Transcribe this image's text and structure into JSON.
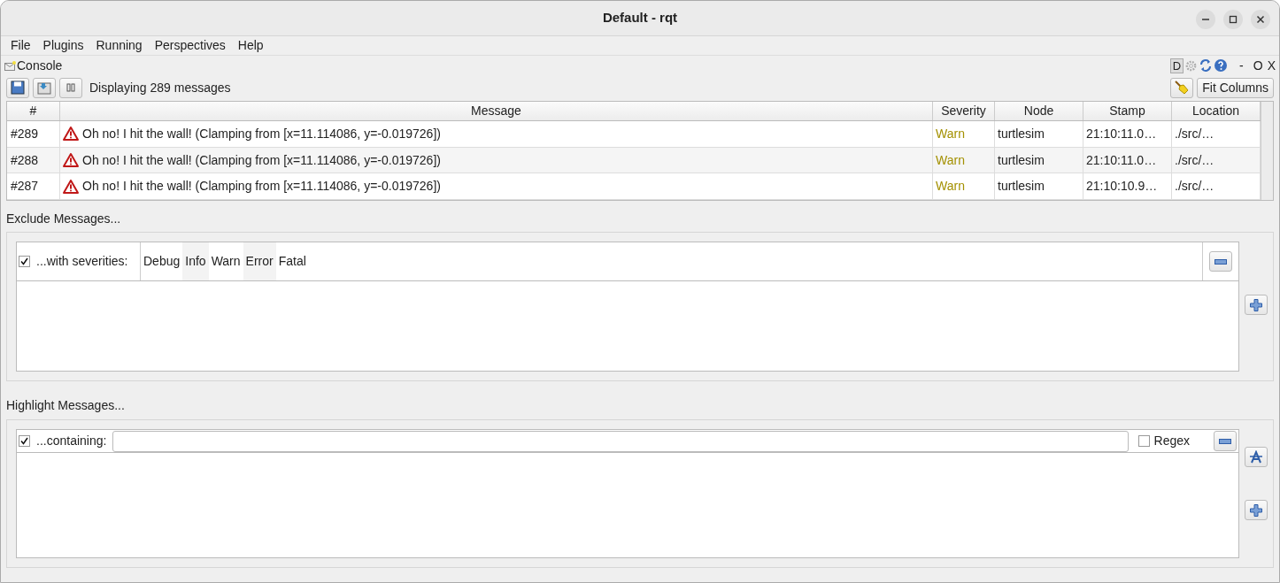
{
  "window": {
    "title": "Default - rqt"
  },
  "menu": [
    "File",
    "Plugins",
    "Running",
    "Perspectives",
    "Help"
  ],
  "plugin": {
    "title": "Console",
    "corner_letter": "D",
    "corner_controls": [
      "-",
      "O",
      "X"
    ]
  },
  "toolbar": {
    "status": "Displaying 289 messages",
    "fit_button": "Fit Columns"
  },
  "table": {
    "columns": [
      "#",
      "Message",
      "Severity",
      "Node",
      "Stamp",
      "Location"
    ],
    "rows": [
      {
        "number": "#289",
        "message": "Oh no! I hit the wall! (Clamping from [x=11.114086, y=-0.019726])",
        "severity": "Warn",
        "node": "turtlesim",
        "stamp": "21:10:11.0…",
        "location": "./src/…"
      },
      {
        "number": "#288",
        "message": "Oh no! I hit the wall! (Clamping from [x=11.114086, y=-0.019726])",
        "severity": "Warn",
        "node": "turtlesim",
        "stamp": "21:10:11.0…",
        "location": "./src/…"
      },
      {
        "number": "#287",
        "message": "Oh no! I hit the wall! (Clamping from [x=11.114086, y=-0.019726])",
        "severity": "Warn",
        "node": "turtlesim",
        "stamp": "21:10:10.9…",
        "location": "./src/…"
      }
    ]
  },
  "exclude": {
    "title": "Exclude Messages...",
    "checked": true,
    "label": "...with severities:",
    "severities": [
      "Debug",
      "Info",
      "Warn",
      "Error",
      "Fatal"
    ]
  },
  "highlight": {
    "title": "Highlight Messages...",
    "checked": true,
    "label": "...containing:",
    "regex_label": "Regex",
    "regex_checked": false
  }
}
